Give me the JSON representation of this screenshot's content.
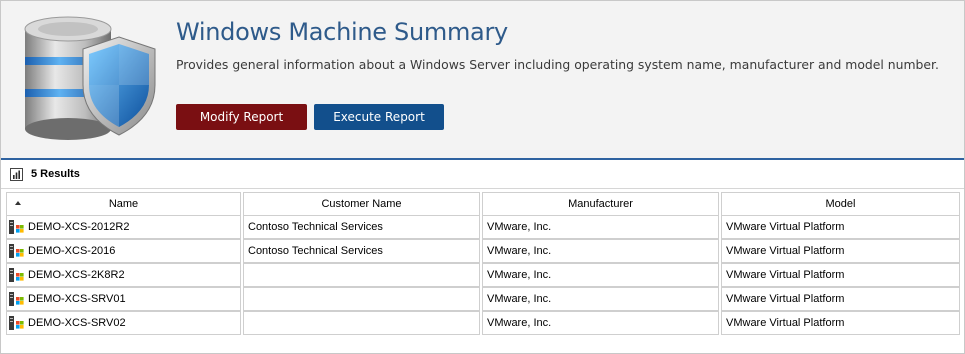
{
  "report": {
    "title": "Windows Machine Summary",
    "description": "Provides general information about a Windows Server including operating system name, manufacturer and model number.",
    "logo_icon": "database-shield-icon"
  },
  "actions": {
    "modify_label": "Modify Report",
    "execute_label": "Execute Report"
  },
  "results": {
    "count_label": "5 Results",
    "icon": "chart-icon"
  },
  "table": {
    "sort_column": "Name",
    "sort_direction": "ascending",
    "columns": [
      "Name",
      "Customer Name",
      "Manufacturer",
      "Model"
    ],
    "row_icon": "windows-server-icon",
    "rows": [
      {
        "name": "DEMO-XCS-2012R2",
        "customer": "Contoso Technical Services",
        "manufacturer": "VMware, Inc.",
        "model": "VMware Virtual Platform"
      },
      {
        "name": "DEMO-XCS-2016",
        "customer": "Contoso Technical Services",
        "manufacturer": "VMware, Inc.",
        "model": "VMware Virtual Platform"
      },
      {
        "name": "DEMO-XCS-2K8R2",
        "customer": "",
        "manufacturer": "VMware, Inc.",
        "model": "VMware Virtual Platform"
      },
      {
        "name": "DEMO-XCS-SRV01",
        "customer": "",
        "manufacturer": "VMware, Inc.",
        "model": "VMware Virtual Platform"
      },
      {
        "name": "DEMO-XCS-SRV02",
        "customer": "",
        "manufacturer": "VMware, Inc.",
        "model": "VMware Virtual Platform"
      }
    ]
  },
  "colors": {
    "title": "#2e5a8a",
    "modify_button": "#7a0f12",
    "execute_button": "#124f8c",
    "divider": "#2e62a0"
  }
}
